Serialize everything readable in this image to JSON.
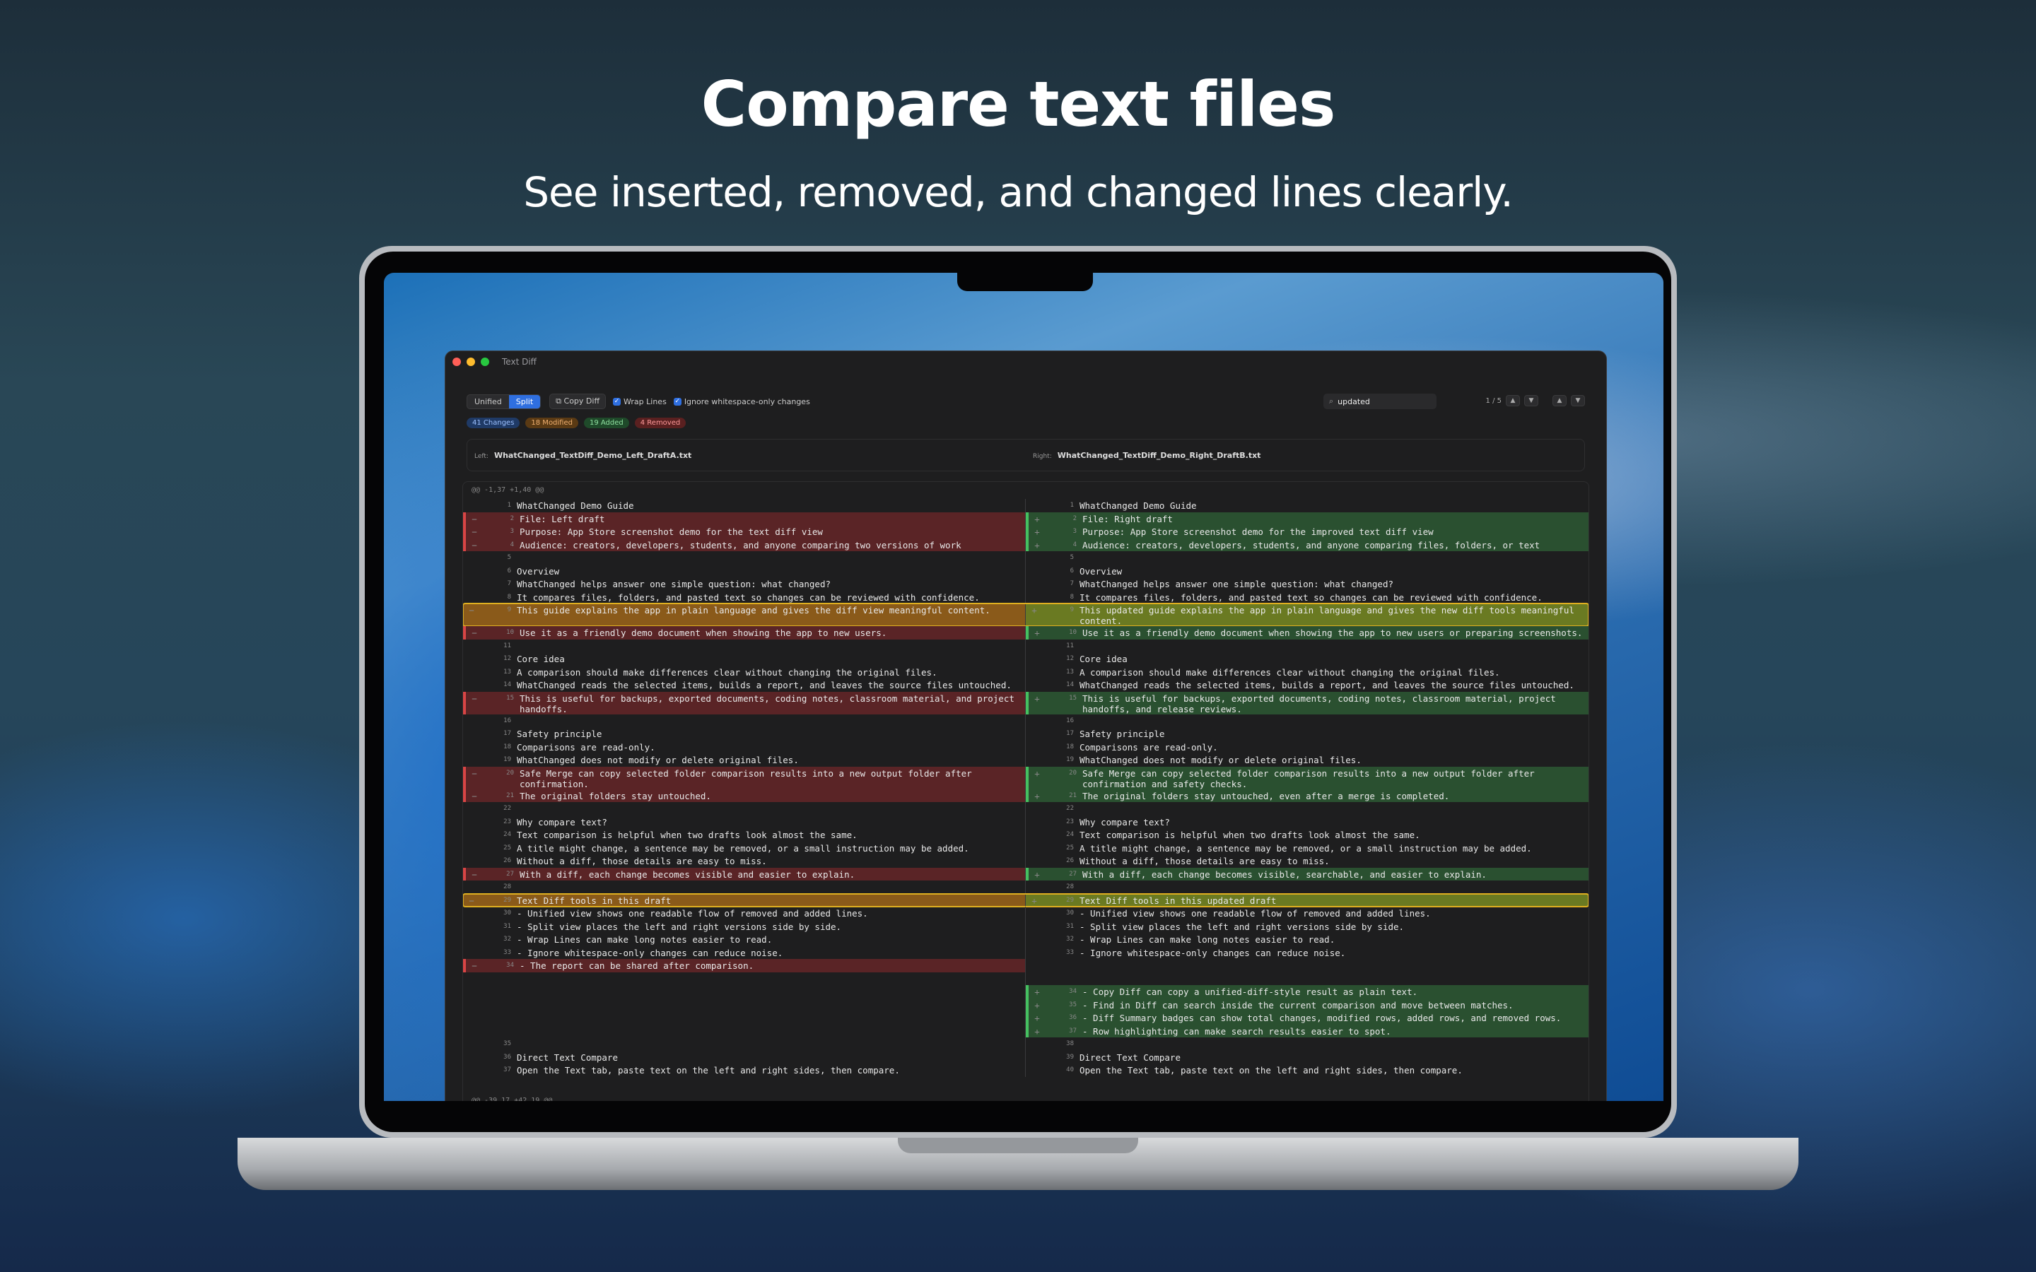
{
  "hero": {
    "title": "Compare text files",
    "subtitle": "See inserted, removed, and changed lines clearly."
  },
  "window": {
    "title": "Text Diff"
  },
  "toolbar": {
    "unified": "Unified",
    "split": "Split",
    "copy": "Copy Diff",
    "wrap": "Wrap Lines",
    "ignore_ws": "Ignore whitespace-only changes",
    "search_value": "updated",
    "match_count": "1 / 5"
  },
  "badges": {
    "changes": "41 Changes",
    "modified": "18 Modified",
    "added": "19 Added",
    "removed": "4 Removed"
  },
  "files": {
    "left_label": "Left:",
    "left_name": "WhatChanged_TextDiff_Demo_Left_DraftA.txt",
    "right_label": "Right:",
    "right_name": "WhatChanged_TextDiff_Demo_Right_DraftB.txt"
  },
  "hunks": {
    "top": "@@ -1,37 +1,40 @@",
    "bottom": "@@ -39,17 +42,19 @@"
  },
  "colors": {
    "accent": "#2f6fe0",
    "removed": "#d94545",
    "added": "#45c060",
    "highlight": "#e0b020"
  },
  "rows": [
    {
      "l": {
        "n": "1",
        "t": "WhatChanged Demo Guide"
      },
      "r": {
        "n": "1",
        "t": "WhatChanged Demo Guide"
      }
    },
    {
      "l": {
        "k": "rem",
        "n": "2",
        "t": "File: Left draft"
      },
      "r": {
        "k": "add",
        "n": "2",
        "t": "File: Right draft"
      }
    },
    {
      "l": {
        "k": "rem",
        "n": "3",
        "t": "Purpose: App Store screenshot demo for the text diff view"
      },
      "r": {
        "k": "add",
        "n": "3",
        "t": "Purpose: App Store screenshot demo for the improved text diff view"
      }
    },
    {
      "l": {
        "k": "rem",
        "n": "4",
        "t": "Audience: creators, developers, students, and anyone comparing two versions of work"
      },
      "r": {
        "k": "add",
        "n": "4",
        "t": "Audience: creators, developers, students, and anyone comparing files, folders, or text"
      }
    },
    {
      "l": {
        "n": "5",
        "t": ""
      },
      "r": {
        "n": "5",
        "t": ""
      }
    },
    {
      "l": {
        "n": "6",
        "t": "Overview"
      },
      "r": {
        "n": "6",
        "t": "Overview"
      }
    },
    {
      "l": {
        "n": "7",
        "t": "WhatChanged helps answer one simple question: what changed?"
      },
      "r": {
        "n": "7",
        "t": "WhatChanged helps answer one simple question: what changed?"
      }
    },
    {
      "l": {
        "n": "8",
        "t": "It compares files, folders, and pasted text so changes can be reviewed with confidence."
      },
      "r": {
        "n": "8",
        "t": "It compares files, folders, and pasted text so changes can be reviewed with confidence."
      }
    },
    {
      "hl": true,
      "l": {
        "k": "chg",
        "n": "9",
        "t": "This guide explains the app in plain language and gives the diff view meaningful content."
      },
      "r": {
        "k": "chgr",
        "n": "9",
        "t": "This updated guide explains the app in plain language and gives the new diff tools meaningful content."
      }
    },
    {
      "l": {
        "k": "rem",
        "n": "10",
        "t": "Use it as a friendly demo document when showing the app to new users."
      },
      "r": {
        "k": "add",
        "n": "10",
        "t": "Use it as a friendly demo document when showing the app to new users or preparing screenshots."
      }
    },
    {
      "l": {
        "n": "11",
        "t": ""
      },
      "r": {
        "n": "11",
        "t": ""
      }
    },
    {
      "l": {
        "n": "12",
        "t": "Core idea"
      },
      "r": {
        "n": "12",
        "t": "Core idea"
      }
    },
    {
      "l": {
        "n": "13",
        "t": "A comparison should make differences clear without changing the original files."
      },
      "r": {
        "n": "13",
        "t": "A comparison should make differences clear without changing the original files."
      }
    },
    {
      "l": {
        "n": "14",
        "t": "WhatChanged reads the selected items, builds a report, and leaves the source files untouched."
      },
      "r": {
        "n": "14",
        "t": "WhatChanged reads the selected items, builds a report, and leaves the source files untouched."
      }
    },
    {
      "l": {
        "k": "rem",
        "n": "15",
        "t": "This is useful for backups, exported documents, coding notes, classroom material, and project handoffs."
      },
      "r": {
        "k": "add",
        "n": "15",
        "t": "This is useful for backups, exported documents, coding notes, classroom material, project handoffs, and release reviews."
      }
    },
    {
      "l": {
        "n": "16",
        "t": ""
      },
      "r": {
        "n": "16",
        "t": ""
      }
    },
    {
      "l": {
        "n": "17",
        "t": "Safety principle"
      },
      "r": {
        "n": "17",
        "t": "Safety principle"
      }
    },
    {
      "l": {
        "n": "18",
        "t": "Comparisons are read-only."
      },
      "r": {
        "n": "18",
        "t": "Comparisons are read-only."
      }
    },
    {
      "l": {
        "n": "19",
        "t": "WhatChanged does not modify or delete original files."
      },
      "r": {
        "n": "19",
        "t": "WhatChanged does not modify or delete original files."
      }
    },
    {
      "l": {
        "k": "rem",
        "n": "20",
        "t": "Safe Merge can copy selected folder comparison results into a new output folder after confirmation."
      },
      "r": {
        "k": "add",
        "n": "20",
        "t": "Safe Merge can copy selected folder comparison results into a new output folder after confirmation and safety checks."
      }
    },
    {
      "l": {
        "k": "rem",
        "n": "21",
        "t": "The original folders stay untouched."
      },
      "r": {
        "k": "add",
        "n": "21",
        "t": "The original folders stay untouched, even after a merge is completed."
      }
    },
    {
      "l": {
        "n": "22",
        "t": ""
      },
      "r": {
        "n": "22",
        "t": ""
      }
    },
    {
      "l": {
        "n": "23",
        "t": "Why compare text?"
      },
      "r": {
        "n": "23",
        "t": "Why compare text?"
      }
    },
    {
      "l": {
        "n": "24",
        "t": "Text comparison is helpful when two drafts look almost the same."
      },
      "r": {
        "n": "24",
        "t": "Text comparison is helpful when two drafts look almost the same."
      }
    },
    {
      "l": {
        "n": "25",
        "t": "A title might change, a sentence may be removed, or a small instruction may be added."
      },
      "r": {
        "n": "25",
        "t": "A title might change, a sentence may be removed, or a small instruction may be added."
      }
    },
    {
      "l": {
        "n": "26",
        "t": "Without a diff, those details are easy to miss."
      },
      "r": {
        "n": "26",
        "t": "Without a diff, those details are easy to miss."
      }
    },
    {
      "l": {
        "k": "rem",
        "n": "27",
        "t": "With a diff, each change becomes visible and easier to explain."
      },
      "r": {
        "k": "add",
        "n": "27",
        "t": "With a diff, each change becomes visible, searchable, and easier to explain."
      }
    },
    {
      "l": {
        "n": "28",
        "t": ""
      },
      "r": {
        "n": "28",
        "t": ""
      }
    },
    {
      "hl": true,
      "l": {
        "k": "chg",
        "n": "29",
        "t": "Text Diff tools in this draft"
      },
      "r": {
        "k": "chgr",
        "n": "29",
        "t": "Text Diff tools in this updated draft"
      }
    },
    {
      "l": {
        "n": "30",
        "t": "- Unified view shows one readable flow of removed and added lines."
      },
      "r": {
        "n": "30",
        "t": "- Unified view shows one readable flow of removed and added lines."
      }
    },
    {
      "l": {
        "n": "31",
        "t": "- Split view places the left and right versions side by side."
      },
      "r": {
        "n": "31",
        "t": "- Split view places the left and right versions side by side."
      }
    },
    {
      "l": {
        "n": "32",
        "t": "- Wrap Lines can make long notes easier to read."
      },
      "r": {
        "n": "32",
        "t": "- Wrap Lines can make long notes easier to read."
      }
    },
    {
      "l": {
        "n": "33",
        "t": "- Ignore whitespace-only changes can reduce noise."
      },
      "r": {
        "n": "33",
        "t": "- Ignore whitespace-only changes can reduce noise."
      }
    },
    {
      "l": {
        "k": "rem",
        "n": "34",
        "t": "- The report can be shared after comparison."
      },
      "r": {
        "n": "",
        "t": ""
      }
    },
    {
      "l": {
        "n": "",
        "t": ""
      },
      "r": {
        "n": "",
        "t": ""
      }
    },
    {
      "l": {
        "n": "",
        "t": ""
      },
      "r": {
        "k": "add",
        "n": "34",
        "t": "- Copy Diff can copy a unified-diff-style result as plain text."
      }
    },
    {
      "l": {
        "n": "",
        "t": ""
      },
      "r": {
        "k": "add",
        "n": "35",
        "t": "- Find in Diff can search inside the current comparison and move between matches."
      }
    },
    {
      "l": {
        "n": "",
        "t": ""
      },
      "r": {
        "k": "add",
        "n": "36",
        "t": "- Diff Summary badges can show total changes, modified rows, added rows, and removed rows."
      }
    },
    {
      "l": {
        "n": "",
        "t": ""
      },
      "r": {
        "k": "add",
        "n": "37",
        "t": "- Row highlighting can make search results easier to spot."
      }
    },
    {
      "l": {
        "n": "35",
        "t": ""
      },
      "r": {
        "n": "38",
        "t": ""
      }
    },
    {
      "l": {
        "n": "36",
        "t": "Direct Text Compare"
      },
      "r": {
        "n": "39",
        "t": "Direct Text Compare"
      }
    },
    {
      "l": {
        "n": "37",
        "t": "Open the Text tab, paste text on the left and right sides, then compare."
      },
      "r": {
        "n": "40",
        "t": "Open the Text tab, paste text on the left and right sides, then compare."
      }
    }
  ]
}
